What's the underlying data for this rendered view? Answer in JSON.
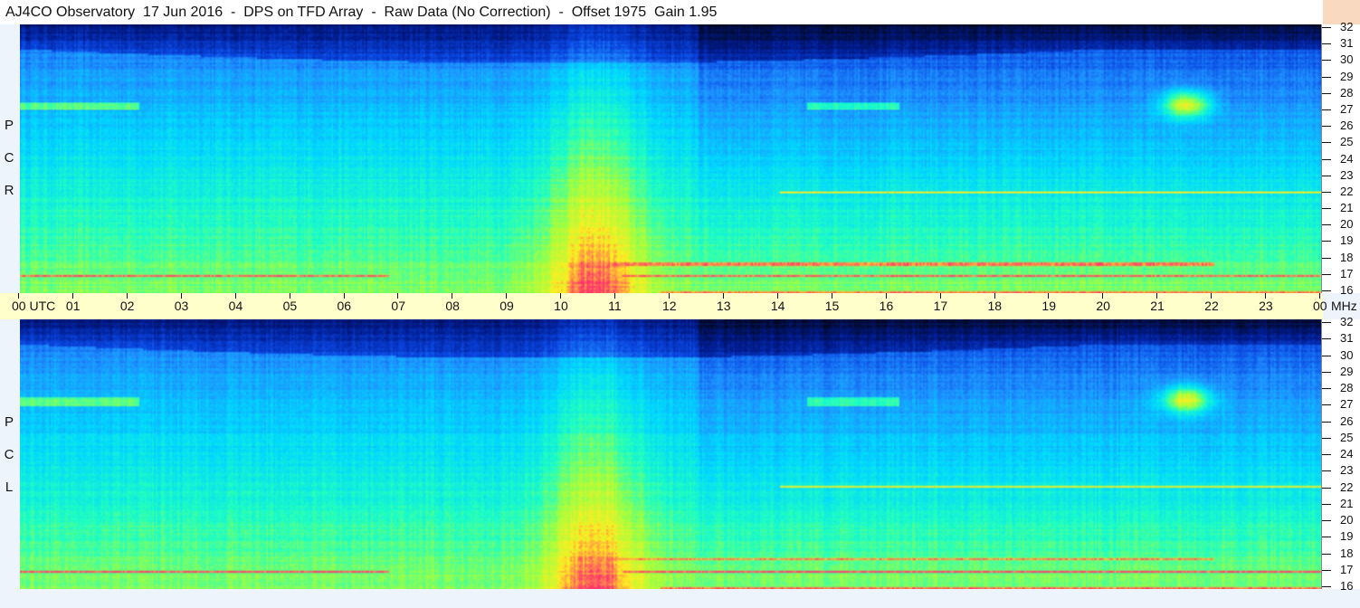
{
  "title": "AJ4CO Observatory  17 Jun 2016  -  DPS on TFD Array  -  Raw Data (No Correction)  -  Offset 1975  Gain 1.95",
  "panels": [
    {
      "id": "rcp",
      "label": [
        "R",
        "C",
        "P"
      ]
    },
    {
      "id": "lcp",
      "label": [
        "L",
        "C",
        "P"
      ]
    }
  ],
  "time_axis": {
    "labels": [
      "00  UTC",
      "01",
      "02",
      "03",
      "04",
      "05",
      "06",
      "07",
      "08",
      "09",
      "10",
      "11",
      "12",
      "13",
      "14",
      "15",
      "16",
      "17",
      "18",
      "19",
      "20",
      "21",
      "22",
      "23",
      "00"
    ],
    "unit": "MHz"
  },
  "freq_axis": {
    "ticks": [
      32,
      31,
      30,
      29,
      28,
      27,
      26,
      25,
      24,
      23,
      22,
      21,
      20,
      19,
      18,
      17,
      16
    ]
  },
  "chart_data": {
    "type": "heatmap",
    "title": "AJ4CO Observatory  17 Jun 2016  -  DPS on TFD Array  -  Raw Data (No Correction)  -  Offset 1975  Gain 1.95",
    "xlabel": "UTC",
    "ylabel": "MHz",
    "x_range_hours_utc": [
      0,
      24
    ],
    "y_range_mhz": [
      16,
      32
    ],
    "series": [
      {
        "name": "RCP"
      },
      {
        "name": "LCP"
      }
    ],
    "colormap": [
      "#000820",
      "#001a8a",
      "#0a45e0",
      "#1e90ff",
      "#00d8ff",
      "#20ffc0",
      "#a0ff40",
      "#ffee20",
      "#ff3070"
    ]
  }
}
